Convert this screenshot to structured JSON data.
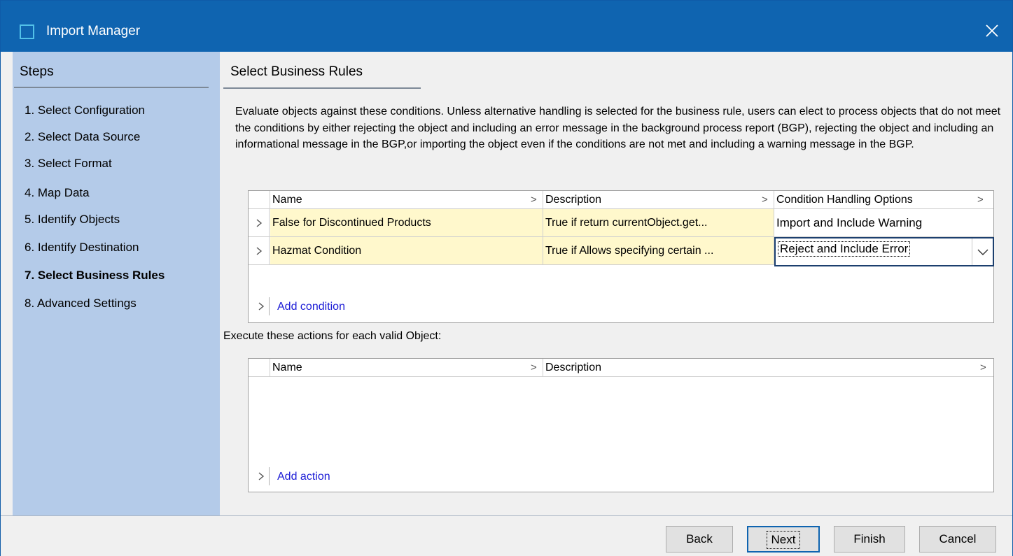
{
  "window": {
    "title": "Import Manager",
    "icon": "app-window-icon",
    "close_icon": "close-icon"
  },
  "sidebar": {
    "header": "Steps",
    "steps": [
      {
        "label": "1. Select Configuration"
      },
      {
        "label": "2. Select Data Source"
      },
      {
        "label": "3. Select Format"
      },
      {
        "label": "4. Map Data"
      },
      {
        "label": "5. Identify Objects"
      },
      {
        "label": "6. Identify Destination"
      },
      {
        "label": "7. Select Business Rules",
        "active": true
      },
      {
        "label": "8. Advanced Settings"
      }
    ]
  },
  "main": {
    "title": "Select Business Rules",
    "instructions": "Evaluate objects against these conditions. Unless alternative handling is selected for the business rule, users can elect to process objects that do not meet the conditions by either rejecting the object and including an error message in the background process report (BGP), rejecting the object and including an informational message in the BGP,or importing the object even if the conditions are not met and including a warning message in the BGP.",
    "conditions": {
      "columns": [
        "Name",
        "Description",
        "Condition Handling Options"
      ],
      "rows": [
        {
          "name": "False for Discontinued Products",
          "description": "True if return currentObject.get...",
          "handling": "Import and Include Warning"
        },
        {
          "name": "Hazmat Condition",
          "description": "True if Allows specifying certain ...",
          "handling": "Reject and Include Error"
        }
      ],
      "add_label": "Add condition"
    },
    "actions_label": "Execute these actions for each valid Object:",
    "actions": {
      "columns": [
        "Name",
        "Description"
      ],
      "rows": [],
      "add_label": "Add action"
    }
  },
  "buttons": {
    "back": "Back",
    "next": "Next",
    "finish": "Finish",
    "cancel": "Cancel"
  },
  "colors": {
    "titlebar": "#0f64b0",
    "sidebar": "#b4cbe9",
    "highlight_cell": "#fff8cc",
    "link": "#1c1cd6"
  }
}
